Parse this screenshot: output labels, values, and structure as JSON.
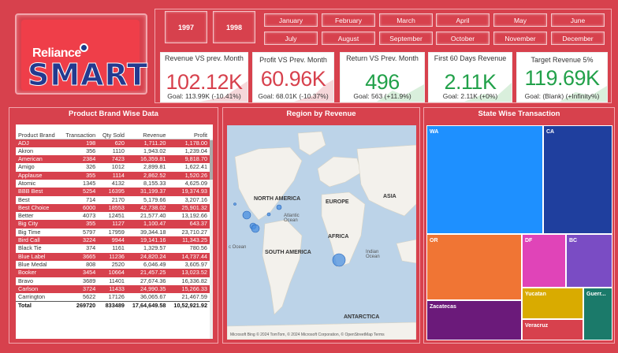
{
  "logo": {
    "brand": "Reliance",
    "product": "SMART"
  },
  "years": [
    "1997",
    "1998"
  ],
  "months": [
    "January",
    "February",
    "March",
    "April",
    "May",
    "June",
    "July",
    "August",
    "September",
    "October",
    "November",
    "December"
  ],
  "kpis": [
    {
      "title": "Revenue VS prev. Month",
      "value": "102.12K",
      "goal": "Goal: 113.99K (-10.41%)",
      "color": "#d7414d"
    },
    {
      "title": "Profit VS Prev. Month",
      "value": "60.96K",
      "goal": "Goal: 68.01K (-10.37%)",
      "color": "#d7414d"
    },
    {
      "title": "Return VS Prev. Month",
      "value": "496",
      "goal": "Goal: 563 (+11.9%)",
      "color": "#22a14a"
    },
    {
      "title": "First 60 Days Revenue",
      "value": "2.11K",
      "goal": "Goal: 2.11K (+0%)",
      "color": "#22a14a"
    },
    {
      "title": "Target Revenue 5%",
      "value": "119.69K",
      "goal": "Goal: (Blank) (+Infinity%)",
      "color": "#22a14a"
    }
  ],
  "brand_panel": {
    "title": "Product Brand Wise Data",
    "columns": [
      "Product Brand",
      "Transaction",
      "Qty Sold",
      "Revenue",
      "Profit"
    ],
    "rows": [
      [
        "ADJ",
        "198",
        "620",
        "1,711.20",
        "1,178.00"
      ],
      [
        "Akron",
        "356",
        "1110",
        "1,943.02",
        "1,239.04"
      ],
      [
        "American",
        "2384",
        "7423",
        "16,359.81",
        "9,818.70"
      ],
      [
        "Amigo",
        "326",
        "1012",
        "2,899.81",
        "1,622.41"
      ],
      [
        "Applause",
        "355",
        "1114",
        "2,862.52",
        "1,520.26"
      ],
      [
        "Atomic",
        "1345",
        "4132",
        "8,155.33",
        "4,625.09"
      ],
      [
        "BBB Best",
        "5254",
        "16395",
        "31,199.37",
        "19,374.93"
      ],
      [
        "Best",
        "714",
        "2170",
        "5,179.66",
        "3,207.16"
      ],
      [
        "Best Choice",
        "6000",
        "18553",
        "42,738.02",
        "25,901.32"
      ],
      [
        "Better",
        "4073",
        "12451",
        "21,577.40",
        "13,192.66"
      ],
      [
        "Big City",
        "355",
        "1127",
        "1,100.47",
        "643.37"
      ],
      [
        "Big Time",
        "5797",
        "17959",
        "39,344.18",
        "23,710.27"
      ],
      [
        "Bird Call",
        "3224",
        "9944",
        "19,141.16",
        "11,343.25"
      ],
      [
        "Black Tie",
        "374",
        "1161",
        "1,329.57",
        "780.56"
      ],
      [
        "Blue Label",
        "3665",
        "11236",
        "24,820.24",
        "14,737.44"
      ],
      [
        "Blue Medal",
        "808",
        "2520",
        "6,046.49",
        "3,605.97"
      ],
      [
        "Booker",
        "3454",
        "10664",
        "21,457.25",
        "13,023.52"
      ],
      [
        "Bravo",
        "3689",
        "11401",
        "27,674.36",
        "16,336.82"
      ],
      [
        "Carlson",
        "3724",
        "11433",
        "24,990.35",
        "15,266.33"
      ],
      [
        "Carrington",
        "5622",
        "17126",
        "36,065.67",
        "21,467.59"
      ]
    ],
    "total": [
      "Total",
      "269720",
      "833489",
      "17,64,649.58",
      "10,52,921.92"
    ]
  },
  "map_panel": {
    "title": "Region by Revenue",
    "continents": [
      "NORTH AMERICA",
      "EUROPE",
      "ASIA",
      "AFRICA",
      "SOUTH AMERICA",
      "ANTARCTICA"
    ],
    "oceans": [
      "Atlantic Ocean",
      "Indian Ocean",
      "c Ocean"
    ],
    "footer": "Microsoft Bing   © 2024 TomTom, © 2024 Microsoft Corporation, © OpenStreetMap  Terms"
  },
  "tree_panel": {
    "title": "State Wise Transaction",
    "tiles": [
      {
        "label": "WA",
        "color": "#1e90ff"
      },
      {
        "label": "CA",
        "color": "#1f3f9e"
      },
      {
        "label": "OR",
        "color": "#f07534"
      },
      {
        "label": "DF",
        "color": "#e044b8"
      },
      {
        "label": "BC",
        "color": "#7a4cc4"
      },
      {
        "label": "Zacatecas",
        "color": "#6b1a7a"
      },
      {
        "label": "Yucatan",
        "color": "#d9ab00"
      },
      {
        "label": "Veracruz",
        "color": "#d7414d"
      },
      {
        "label": "Guerr...",
        "color": "#1b7a6a"
      }
    ]
  }
}
